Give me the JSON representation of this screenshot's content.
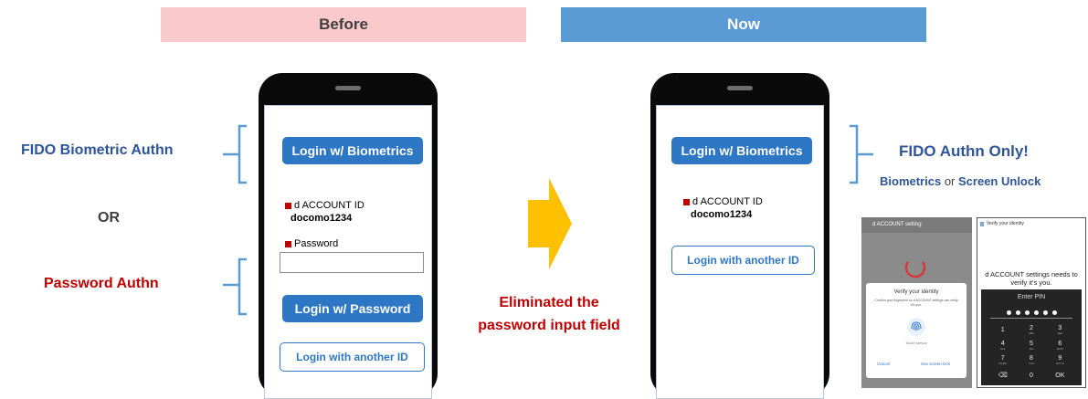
{
  "headers": {
    "before": "Before",
    "now": "Now"
  },
  "colors": {
    "before_bg": "#f9c9cb",
    "now_bg": "#5b9bd5",
    "fido_blue": "#2e5597",
    "password_red": "#c00000",
    "button_blue": "#2e77c5",
    "arrow_yellow": "#ffc000"
  },
  "left_labels": {
    "fido": "FIDO Biometric Authn",
    "or": "OR",
    "password": "Password Authn"
  },
  "before_phone": {
    "biometric_button": "Login w/ Biometrics",
    "account_id_label": "d ACCOUNT ID",
    "account_id_value": "docomo1234",
    "password_label": "Password",
    "password_button": "Login w/ Password",
    "another_id_button": "Login with another ID"
  },
  "arrow_caption": {
    "line1": "Eliminated the",
    "line2": "password input field"
  },
  "now_phone": {
    "biometric_button": "Login w/ Biometrics",
    "account_id_label": "d ACCOUNT ID",
    "account_id_value": "docomo1234",
    "another_id_button": "Login with another ID"
  },
  "right_labels": {
    "title": "FIDO Authn Only!",
    "sub_biometrics": "Biometrics",
    "sub_or": "or",
    "sub_unlock": "Screen Unlock"
  },
  "screenshot_fingerprint": {
    "title_bar": "d ACCOUNT setting",
    "dialog_title": "Verify your identity",
    "dialog_text": "Confirm your fingerprint so d ACCOUNT settings can verify it's you.",
    "touch_text": "Touch sensor",
    "cancel": "Cancel",
    "use_lock": "Use screen lock"
  },
  "screenshot_pin": {
    "title_bar": "Verify your identity",
    "message": "d ACCOUNT settings needs to verify it's you.",
    "enter_pin": "Enter PIN",
    "keys": [
      "1",
      "2",
      "3",
      "4",
      "5",
      "6",
      "7",
      "8",
      "9",
      "⌫",
      "0",
      "OK"
    ],
    "key_letters": [
      "",
      "ABC",
      "DEF",
      "GHI",
      "JKL",
      "MNO",
      "PQRS",
      "TUV",
      "WXYZ",
      "",
      "",
      ""
    ]
  }
}
